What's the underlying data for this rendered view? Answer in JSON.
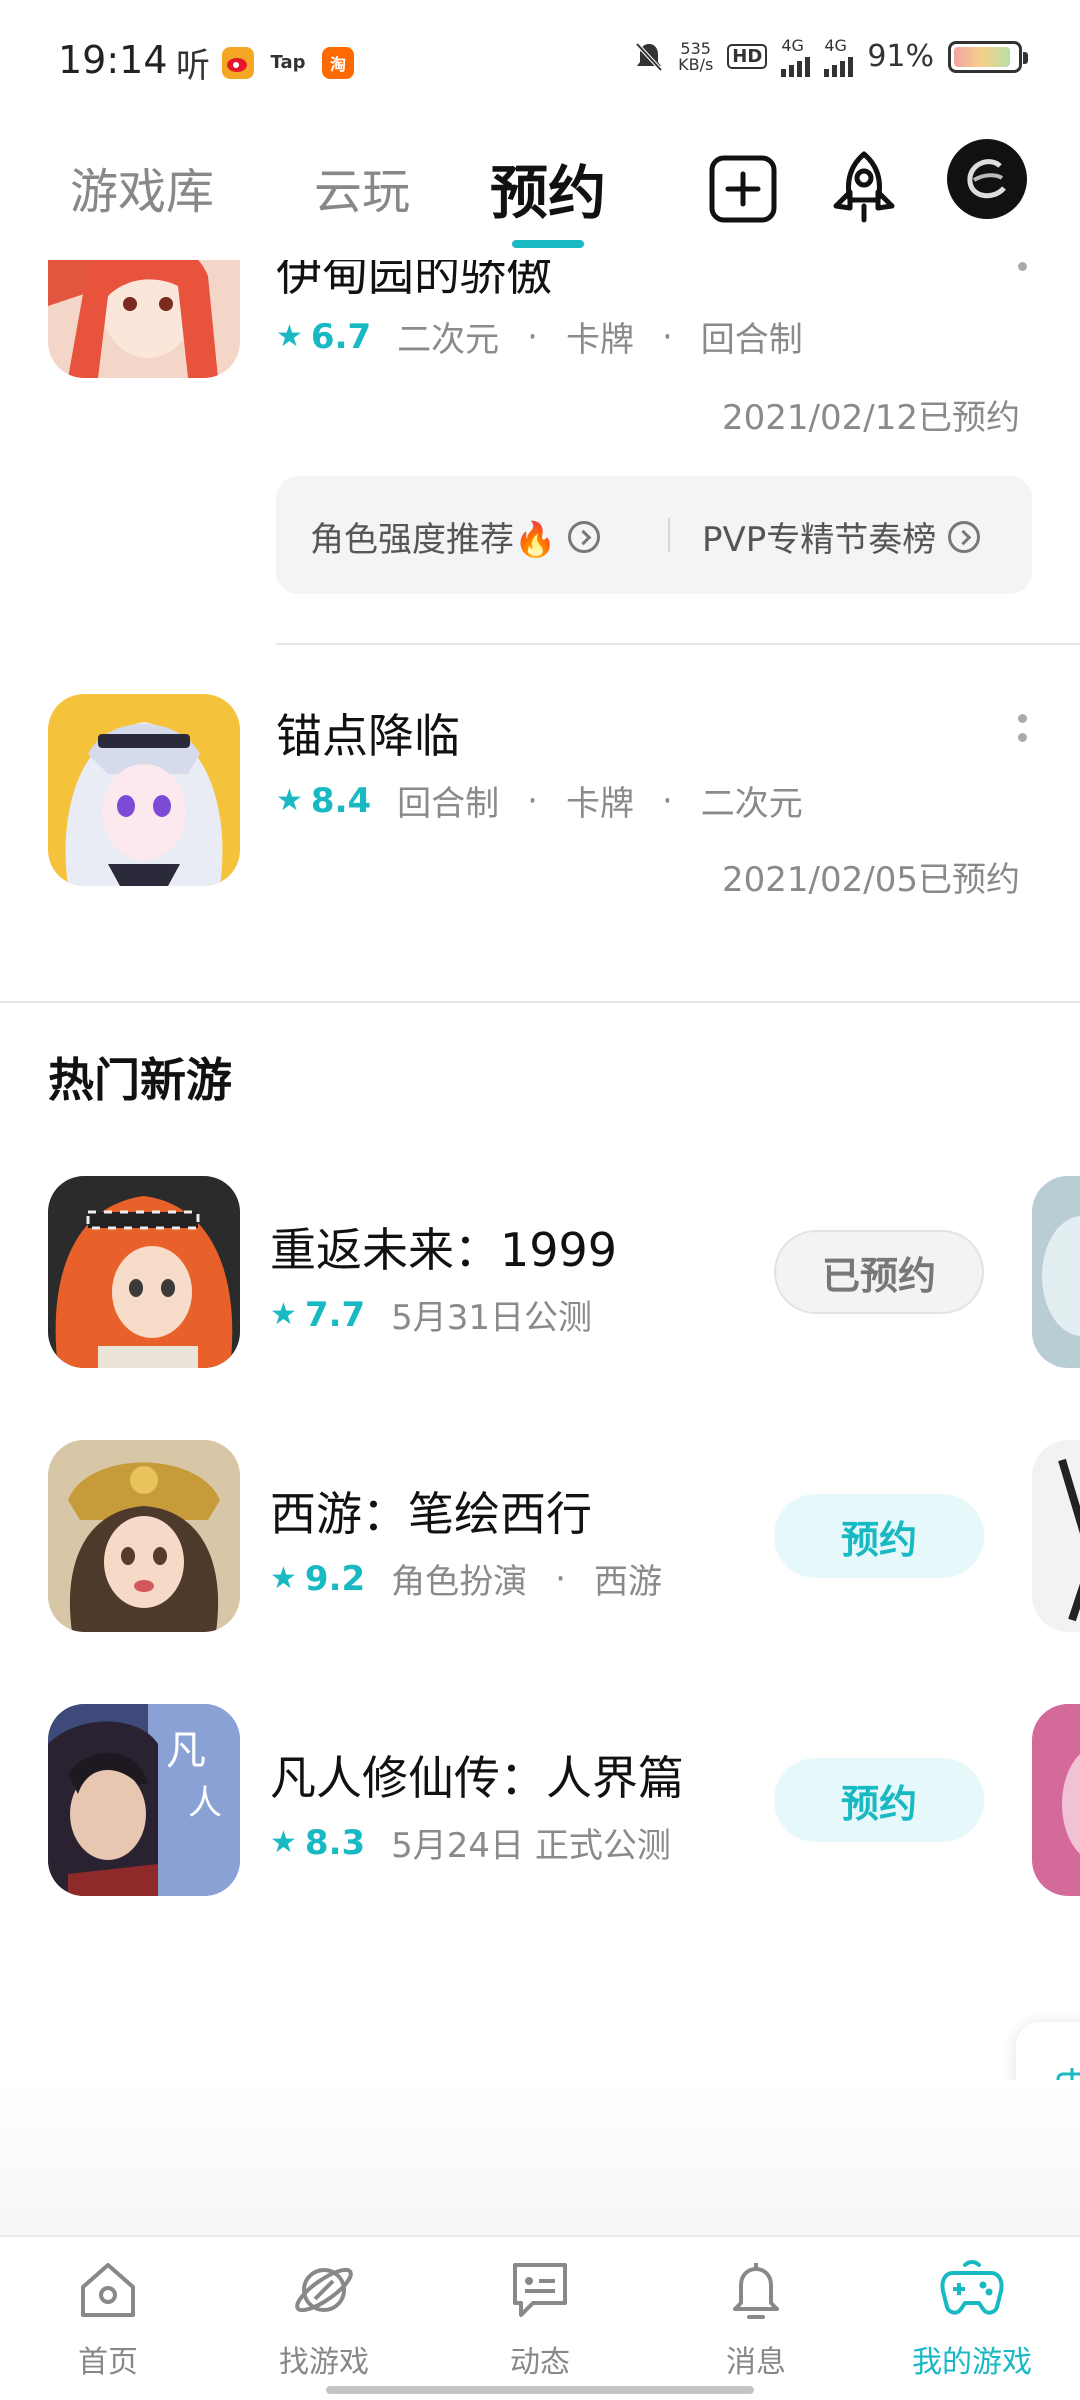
{
  "status_bar": {
    "time": "19:14",
    "listen_glyph": "听",
    "tap_label": "Tap",
    "speed_value": "535",
    "speed_unit": "KB/s",
    "hd_label": "HD",
    "network_1": "4G",
    "network_2": "4G",
    "battery": "91%",
    "battery_level": 0.91
  },
  "tabs": {
    "library": "游戏库",
    "cloud": "云玩",
    "reserve": "预约"
  },
  "reserved_games": [
    {
      "title": "伊甸园的骄傲",
      "score": "6.7",
      "tags": [
        "二次元",
        "卡牌",
        "回合制"
      ],
      "date": "2021/02/12已预约",
      "tools": [
        "角色强度推荐🔥",
        "PVP专精节奏榜"
      ]
    },
    {
      "title": "锚点降临",
      "score": "8.4",
      "tags": [
        "回合制",
        "卡牌",
        "二次元"
      ],
      "date": "2021/02/05已预约"
    }
  ],
  "hot_section": {
    "title": "热门新游",
    "games": [
      {
        "title": "重返未来：1999",
        "score": "7.7",
        "tags": [
          "5月31日公测"
        ],
        "button": "已预约",
        "state": "reserved"
      },
      {
        "title": "西游：笔绘西行",
        "score": "9.2",
        "tags": [
          "角色扮演",
          "西游"
        ],
        "button": "预约",
        "state": "available"
      },
      {
        "title": "凡人修仙传：人界篇",
        "score": "8.3",
        "tags": [
          "5月24日 正式公测"
        ],
        "button": "预约",
        "state": "available"
      }
    ]
  },
  "bottom_nav": {
    "home": "首页",
    "find": "找游戏",
    "feed": "动态",
    "messages": "消息",
    "my_games": "我的游戏"
  },
  "colors": {
    "accent": "#19b9c4",
    "muted_text": "#8a8a8a"
  }
}
